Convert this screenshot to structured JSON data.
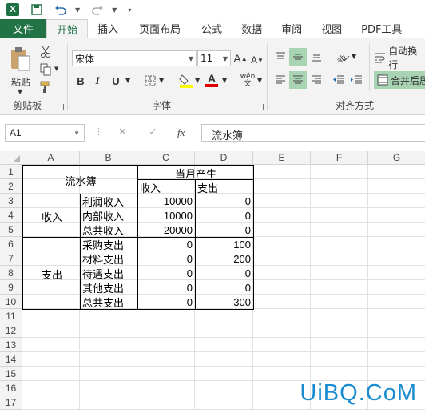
{
  "quick_access": {
    "app_icon": "X",
    "icons": [
      "save-icon",
      "undo-icon",
      "redo-icon",
      "customize-icon"
    ]
  },
  "tabs": [
    "文件",
    "开始",
    "插入",
    "页面布局",
    "公式",
    "数据",
    "审阅",
    "视图",
    "PDF工具"
  ],
  "ribbon": {
    "clipboard": {
      "paste_label": "粘贴",
      "group_label": "剪贴板"
    },
    "font": {
      "name": "宋体",
      "size": "11",
      "grow": "A",
      "shrink": "A",
      "bold": "B",
      "italic": "I",
      "underline": "U",
      "phonetic": "wén",
      "group_label": "字体"
    },
    "alignment": {
      "wrap_label": "自动换行",
      "merge_label": "合并后居",
      "group_label": "对齐方式"
    }
  },
  "formula_bar": {
    "name_box": "A1",
    "cancel": "✕",
    "enter": "✓",
    "fx": "fx",
    "content": "流水簿"
  },
  "columns": [
    "A",
    "B",
    "C",
    "D",
    "E",
    "F",
    "G"
  ],
  "rows": [
    "1",
    "2",
    "3",
    "4",
    "5",
    "6",
    "7",
    "8",
    "9",
    "10",
    "11",
    "12",
    "13",
    "14",
    "15",
    "16",
    "17"
  ],
  "sheet": {
    "title": "流水簿",
    "header_month": "当月产生",
    "header_in": "收入",
    "header_out": "支出",
    "group_income": "收入",
    "group_expense": "支出",
    "items": [
      {
        "label": "利润收入",
        "in": "10000",
        "out": "0"
      },
      {
        "label": "内部收入",
        "in": "10000",
        "out": "0"
      },
      {
        "label": "总共收入",
        "in": "20000",
        "out": "0"
      },
      {
        "label": "采购支出",
        "in": "0",
        "out": "100"
      },
      {
        "label": "材料支出",
        "in": "0",
        "out": "200"
      },
      {
        "label": "待遇支出",
        "in": "0",
        "out": "0"
      },
      {
        "label": "其他支出",
        "in": "0",
        "out": "0"
      },
      {
        "label": "总共支出",
        "in": "0",
        "out": "300"
      }
    ]
  },
  "watermark": "UiBQ.CoM"
}
